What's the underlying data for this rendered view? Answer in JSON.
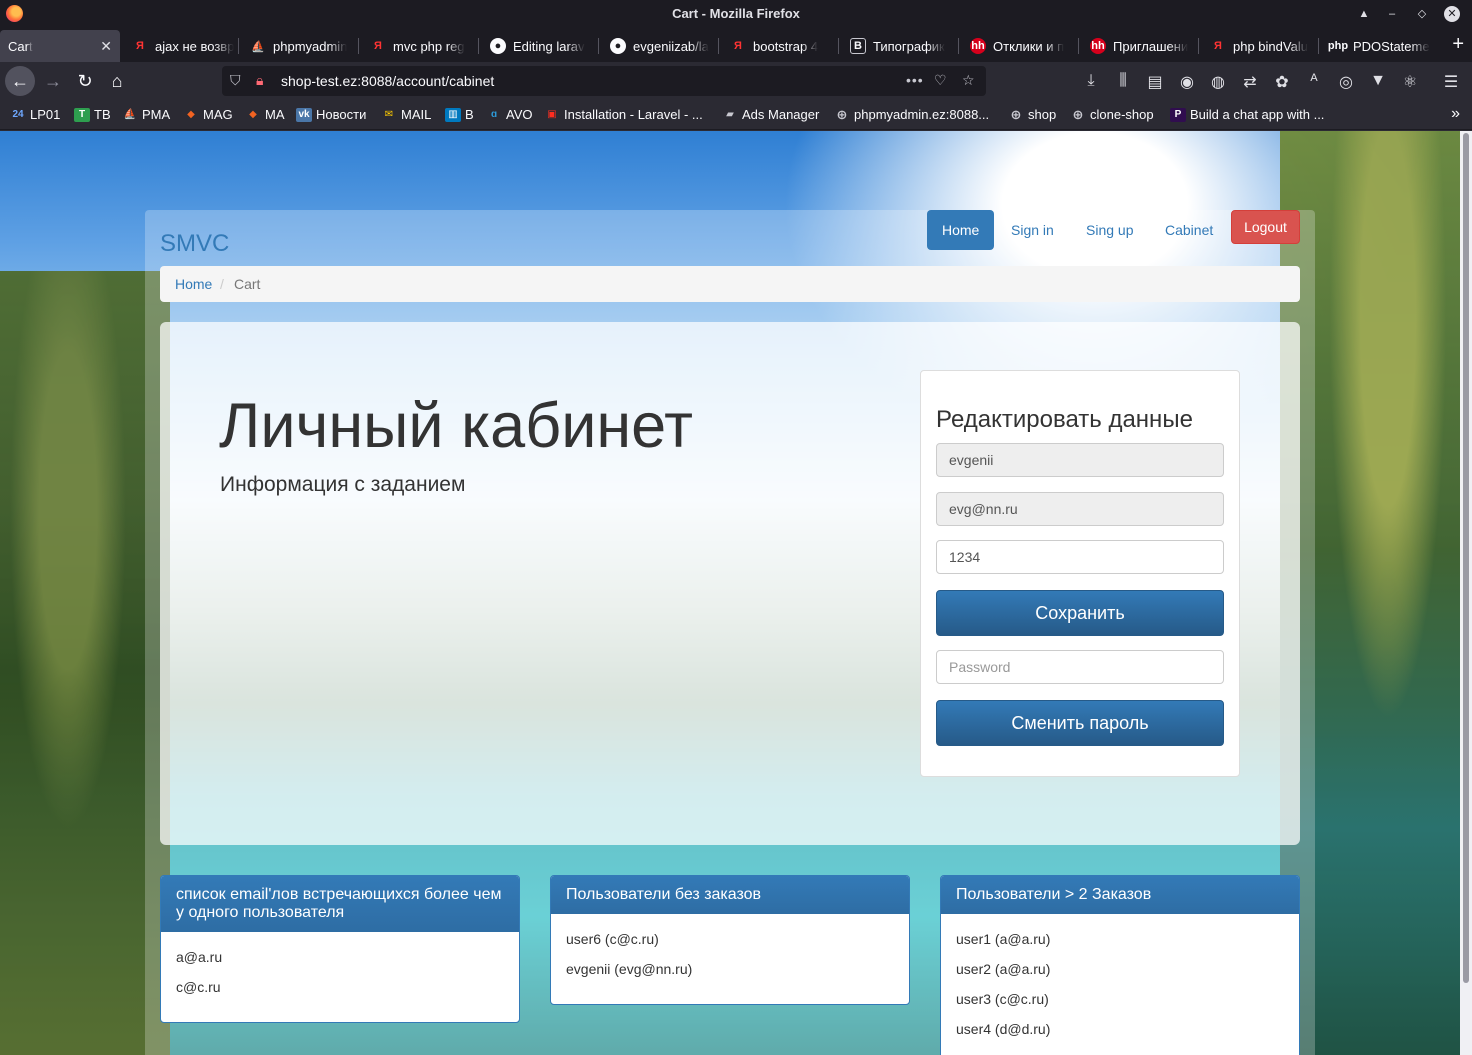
{
  "window": {
    "title": "Cart - Mozilla Firefox"
  },
  "tabs": [
    {
      "label": "Cart",
      "icon": "none",
      "active": true
    },
    {
      "label": "ajax не возвр",
      "icon": "yandex-icon"
    },
    {
      "label": "phpmyadmin",
      "icon": "phpmyadmin-icon"
    },
    {
      "label": "mvc php reg",
      "icon": "yandex-icon"
    },
    {
      "label": "Editing larav",
      "icon": "github-icon"
    },
    {
      "label": "evgeniizab/la",
      "icon": "github-icon"
    },
    {
      "label": "bootstrap 4",
      "icon": "yandex-icon"
    },
    {
      "label": "Типографик",
      "icon": "bootstrap-icon"
    },
    {
      "label": "Отклики и п",
      "icon": "hh-icon"
    },
    {
      "label": "Приглашени",
      "icon": "hh-icon"
    },
    {
      "label": "php bindValu",
      "icon": "yandex-icon"
    },
    {
      "label": "PDOStateme",
      "icon": "php-icon"
    }
  ],
  "url": "shop-test.ez:8088/account/cabinet",
  "bookmarks": [
    {
      "label": "LP01",
      "icon": "lp-icon"
    },
    {
      "label": "TB",
      "icon": "tb-icon"
    },
    {
      "label": "PMA",
      "icon": "phpmyadmin-icon"
    },
    {
      "label": "MAG",
      "icon": "magento-icon"
    },
    {
      "label": "MA",
      "icon": "magento-icon"
    },
    {
      "label": "Новости",
      "icon": "vk-icon"
    },
    {
      "label": "MAIL",
      "icon": "mail-icon"
    },
    {
      "label": "B",
      "icon": "trello-icon"
    },
    {
      "label": "AVO",
      "icon": "avo-icon"
    },
    {
      "label": "Installation - Laravel - ...",
      "icon": "laravel-icon"
    },
    {
      "label": "Ads Manager",
      "icon": "ads-icon"
    },
    {
      "label": "phpmyadmin.ez:8088...",
      "icon": "globe-icon"
    },
    {
      "label": "shop",
      "icon": "globe-icon"
    },
    {
      "label": "clone-shop",
      "icon": "globe-icon"
    },
    {
      "label": "Build a chat app with ...",
      "icon": "pusher-icon"
    }
  ],
  "site": {
    "brand": "SMVC",
    "nav": {
      "home": "Home",
      "signin": "Sign in",
      "signup": "Sing up",
      "cabinet": "Cabinet",
      "logout": "Logout"
    },
    "breadcrumb": {
      "home": "Home",
      "sep": "/",
      "current": "Cart"
    }
  },
  "jumbotron": {
    "title": "Личный кабинет",
    "subtitle": "Информация с заданием"
  },
  "edit_form": {
    "title": "Редактировать данные",
    "username": "evgenii",
    "email": "evg@nn.ru",
    "phone": "1234",
    "save_label": "Сохранить",
    "password_placeholder": "Password",
    "change_password_label": "Сменить пароль"
  },
  "panels": [
    {
      "title": "список email'лов встречающихся более чем у одного пользователя",
      "items": [
        "a@a.ru",
        "c@c.ru"
      ]
    },
    {
      "title": "Пользователи без заказов",
      "items": [
        "user6 (c@c.ru)",
        "evgenii (evg@nn.ru)"
      ]
    },
    {
      "title": "Пользователи > 2 Заказов",
      "items": [
        "user1 (a@a.ru)",
        "user2 (a@a.ru)",
        "user3 (c@c.ru)",
        "user4 (d@d.ru)"
      ]
    }
  ],
  "colors": {
    "primary": "#337ab7",
    "danger": "#d9534f",
    "firefox_dark": "#1c1b22"
  }
}
